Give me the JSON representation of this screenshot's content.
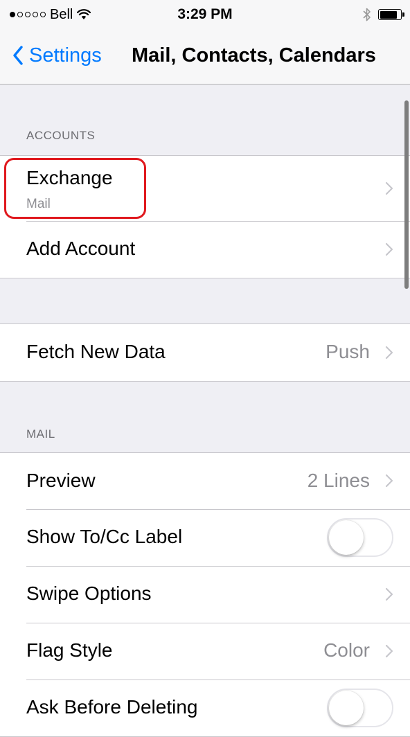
{
  "status_bar": {
    "signal_dots": [
      true,
      false,
      false,
      false,
      false
    ],
    "carrier": "Bell",
    "wifi_icon": "wifi-icon",
    "time": "3:29 PM",
    "bluetooth_icon": "bluetooth-icon",
    "battery_icon": "battery-icon",
    "battery_level": 0.85
  },
  "nav": {
    "back_label": "Settings",
    "back_icon": "chevron-left-icon",
    "title": "Mail, Contacts, Calendars"
  },
  "accounts": {
    "header": "ACCOUNTS",
    "items": [
      {
        "label": "Exchange",
        "sublabel": "Mail"
      },
      {
        "label": "Add Account"
      }
    ]
  },
  "fetch": {
    "label": "Fetch New Data",
    "value": "Push"
  },
  "mail": {
    "header": "MAIL",
    "preview": {
      "label": "Preview",
      "value": "2 Lines"
    },
    "show_to_cc": {
      "label": "Show To/Cc Label",
      "on": false
    },
    "swipe_options": {
      "label": "Swipe Options"
    },
    "flag_style": {
      "label": "Flag Style",
      "value": "Color"
    },
    "ask_before_deleting": {
      "label": "Ask Before Deleting",
      "on": false
    }
  },
  "colors": {
    "ios_blue": "#007aff",
    "highlight_red": "#e0191e",
    "background": "#efeff4",
    "secondary_text": "#8e8e93"
  }
}
